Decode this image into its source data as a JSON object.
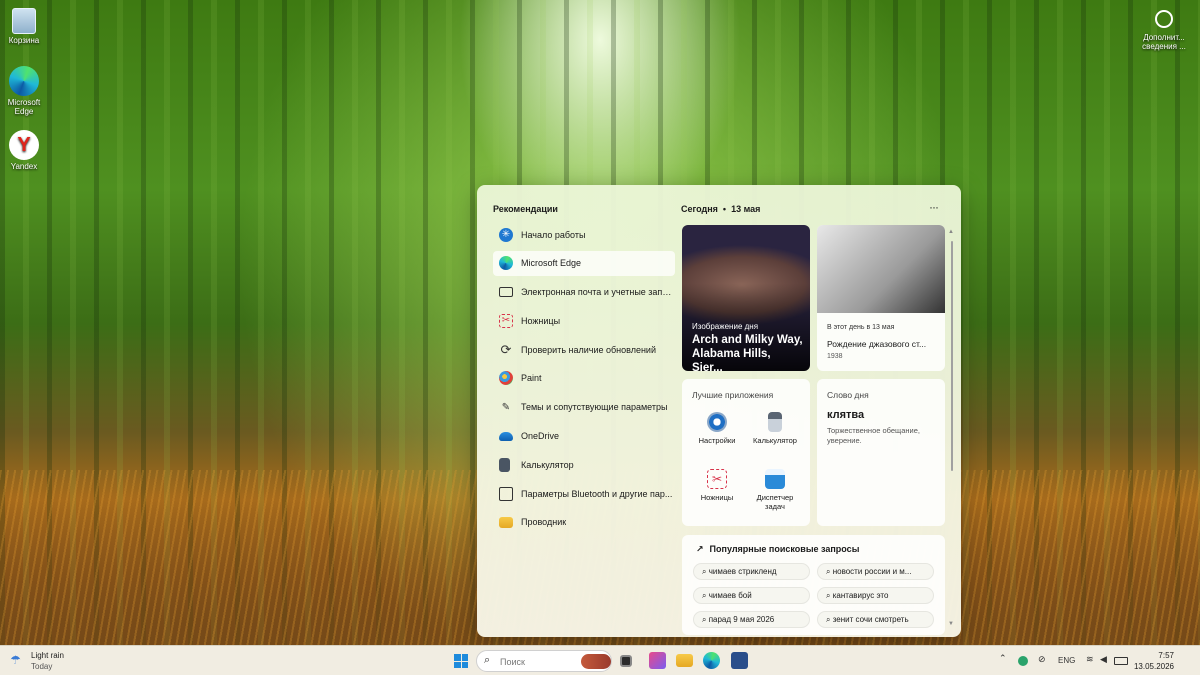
{
  "desktop": {
    "icons": [
      {
        "label": "Корзина"
      },
      {
        "label": "Microsoft Edge"
      },
      {
        "label": "Yandex"
      }
    ],
    "info_icon_label": "Дополнит... сведения ..."
  },
  "start": {
    "recommendations_title": "Рекомендации",
    "recommendations": [
      {
        "label": "Начало работы",
        "icon": "get-started-icon"
      },
      {
        "label": "Microsoft Edge",
        "icon": "edge-icon"
      },
      {
        "label": "Электронная почта и учетные записи",
        "icon": "mail-icon"
      },
      {
        "label": "Ножницы",
        "icon": "snipping-tool-icon"
      },
      {
        "label": "Проверить наличие обновлений",
        "icon": "update-icon"
      },
      {
        "label": "Paint",
        "icon": "paint-icon"
      },
      {
        "label": "Темы и сопутствующие параметры",
        "icon": "pen-icon"
      },
      {
        "label": "OneDrive",
        "icon": "onedrive-icon"
      },
      {
        "label": "Калькулятор",
        "icon": "calculator-icon"
      },
      {
        "label": "Параметры Bluetooth и другие пар...",
        "icon": "bluetooth-icon"
      },
      {
        "label": "Проводник",
        "icon": "folder-icon"
      }
    ],
    "today_label": "Сегодня",
    "date": "13 мая",
    "more_label": "···",
    "photo_card": {
      "label": "Изображение дня",
      "title": "Arch and Milky Way, Alabama Hills, Sier..."
    },
    "history_card": {
      "label": "В этот день в 13 мая",
      "title": "Рождение джазового ст...",
      "year": "1938"
    },
    "apps_card": {
      "title": "Лучшие приложения",
      "apps": [
        {
          "label": "Настройки",
          "icon": "settings-icon"
        },
        {
          "label": "Калькулятор",
          "icon": "calculator-icon"
        },
        {
          "label": "Ножницы",
          "icon": "snipping-tool-icon"
        },
        {
          "label": "Диспетчер задач",
          "icon": "task-manager-icon"
        }
      ]
    },
    "word_card": {
      "title": "Слово дня",
      "word": "клятва",
      "definition": "Торжественное обещание, уверение."
    },
    "trends_card": {
      "title": "Популярные поисковые запросы",
      "queries": [
        "чимаев стрикленд",
        "новости россии и м...",
        "чимаев бой",
        "кантавирус это",
        "парад 9 мая 2026",
        "зенит сочи смотреть"
      ]
    }
  },
  "taskbar": {
    "weather_condition": "Light rain",
    "weather_day": "Today",
    "search_placeholder": "Поиск",
    "language": "ENG",
    "time": "7:57",
    "date": "13.05.2026"
  },
  "colors": {
    "accent": "#1e8bdc",
    "panel_bg": "#eef6dc",
    "taskbar_bg": "#f1ede2"
  }
}
